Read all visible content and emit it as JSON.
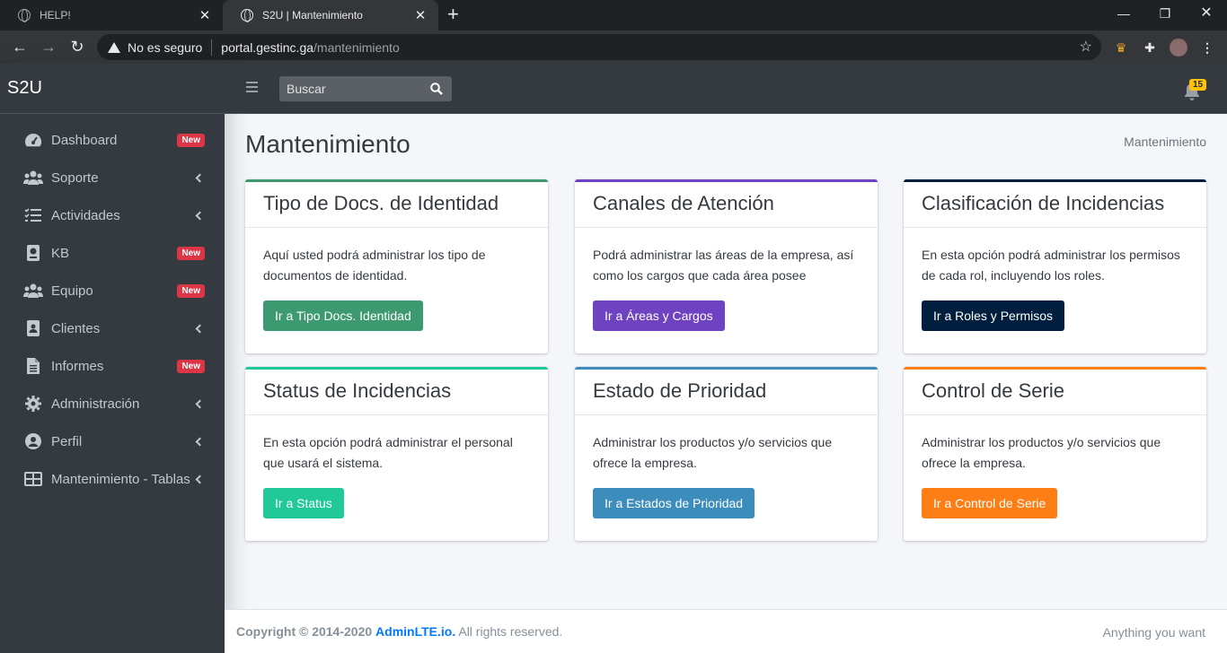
{
  "browser": {
    "tabs": [
      {
        "title": "HELP!",
        "active": false
      },
      {
        "title": "S2U | Mantenimiento",
        "active": true
      }
    ],
    "security_label": "No es seguro",
    "url_host": "portal.gestinc.ga",
    "url_path": "/mantenimiento"
  },
  "sidebar": {
    "brand": "S2U",
    "items": [
      {
        "label": "Dashboard",
        "icon": "tachometer-icon",
        "badge": "New"
      },
      {
        "label": "Soporte",
        "icon": "users-icon",
        "badge": ""
      },
      {
        "label": "Actividades",
        "icon": "tasks-icon",
        "badge": ""
      },
      {
        "label": "KB",
        "icon": "book-icon",
        "badge": "New"
      },
      {
        "label": "Equipo",
        "icon": "team-icon",
        "badge": "New"
      },
      {
        "label": "Clientes",
        "icon": "address-book-icon",
        "badge": ""
      },
      {
        "label": "Informes",
        "icon": "file-icon",
        "badge": "New"
      },
      {
        "label": "Administración",
        "icon": "gear-icon",
        "badge": ""
      },
      {
        "label": "Perfil",
        "icon": "user-circle-icon",
        "badge": ""
      },
      {
        "label": "Mantenimiento - Tablas",
        "icon": "table-icon",
        "badge": ""
      }
    ]
  },
  "topnav": {
    "search_placeholder": "Buscar",
    "notifications_count": "15"
  },
  "page": {
    "title": "Mantenimiento",
    "breadcrumb": "Mantenimiento"
  },
  "cards": [
    {
      "title": "Tipo de Docs. de Identidad",
      "text": "Aquí usted podrá administrar los tipo de documentos de identidad.",
      "button": "Ir a Tipo Docs. Identidad",
      "color": "#3d9970"
    },
    {
      "title": "Canales de Atención",
      "text": "Podrá administrar las áreas de la empresa, así como los cargos que cada área posee",
      "button": "Ir a Áreas y Cargos",
      "color": "#6f42c1"
    },
    {
      "title": "Clasificación de Incidencias",
      "text": "En esta opción podrá administrar los permisos de cada rol, incluyendo los roles.",
      "button": "Ir a Roles y Permisos",
      "color": "#001f3f"
    },
    {
      "title": "Status de Incidencias",
      "text": "En esta opción podrá administrar el personal que usará el sistema.",
      "button": "Ir a Status",
      "color": "#20c997"
    },
    {
      "title": "Estado de Prioridad",
      "text": "Administrar los productos y/o servicios que ofrece la empresa.",
      "button": "Ir a Estados de Prioridad",
      "color": "#3c8dbc"
    },
    {
      "title": "Control de Serie",
      "text": "Administrar los productos y/o servicios que ofrece la empresa.",
      "button": "Ir a Control de Serie",
      "color": "#fd7e14"
    }
  ],
  "footer": {
    "copyright_prefix": "Copyright © 2014-2020",
    "link": "AdminLTE.io.",
    "suffix": "All rights reserved.",
    "right": "Anything you want"
  }
}
